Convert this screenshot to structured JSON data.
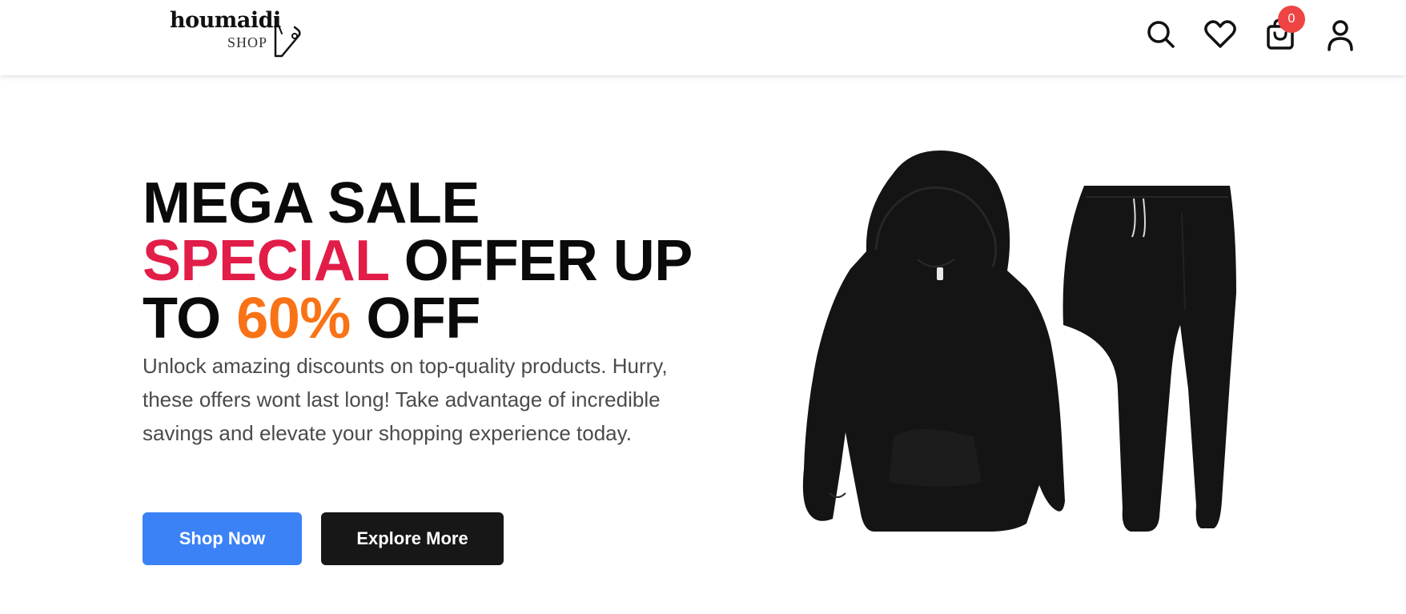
{
  "brand": {
    "name": "houmaidi",
    "sub": "SHOP"
  },
  "nav": {
    "icons": [
      "search-icon",
      "heart-icon",
      "cart-icon",
      "user-icon"
    ],
    "cart_count": "0",
    "badge_color": "#ef4444"
  },
  "hero": {
    "title_line1": "MEGA SALE",
    "title_special": "SPECIAL",
    "title_line2_rest": "OFFER UP",
    "title_to": "TO",
    "title_percent": "60%",
    "title_off": "OFF",
    "description": "Unlock amazing discounts on top-quality products. Hurry, these offers wont last long! Take advantage of incredible savings and elevate your shopping experience today.",
    "primary_button": "Shop Now",
    "secondary_button": "Explore More",
    "image": "black-hoodie-and-joggers"
  },
  "colors": {
    "accent_blue": "#3b82f6",
    "special_red": "#e11d48",
    "percent_orange": "#f97316",
    "dark_button": "#171717"
  }
}
